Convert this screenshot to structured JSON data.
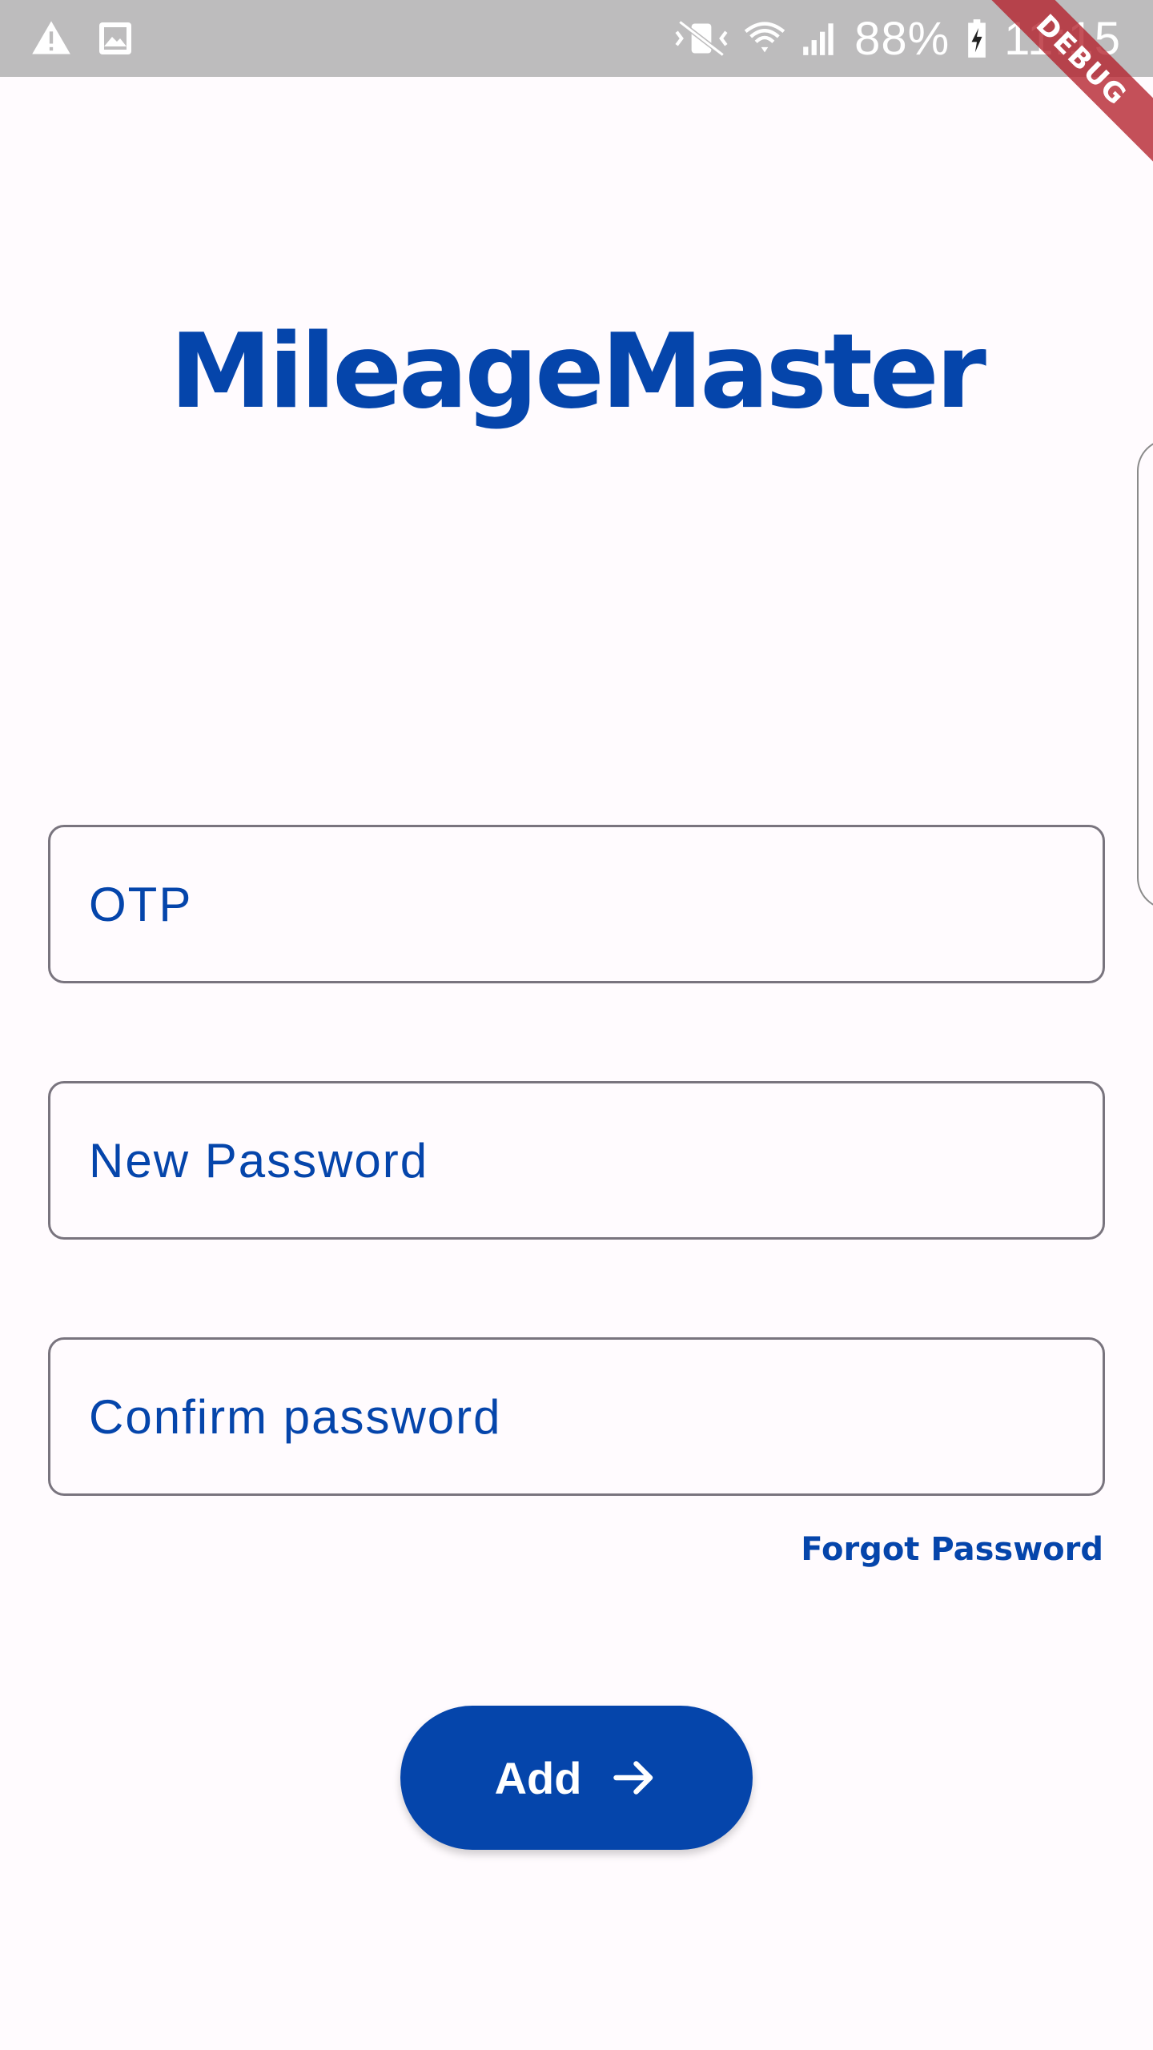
{
  "status_bar": {
    "battery_percent": "88%",
    "time": "11:15",
    "icons": [
      "warning-icon",
      "image-icon",
      "vibrate-off-icon",
      "wifi-icon",
      "signal-icon",
      "battery-charging-icon"
    ]
  },
  "debug_banner": "DEBUG",
  "app": {
    "title": "MileageMaster"
  },
  "form": {
    "otp_label": "OTP",
    "new_password_label": "New Password",
    "confirm_password_label": "Confirm password",
    "forgot_password_link": "Forgot Password",
    "submit_label": "Add",
    "submit_icon": "arrow-right-icon"
  },
  "colors": {
    "primary": "#0545ab",
    "background": "#fffbfe",
    "status_bar": "#bdbcbd",
    "field_border": "#79747e"
  }
}
